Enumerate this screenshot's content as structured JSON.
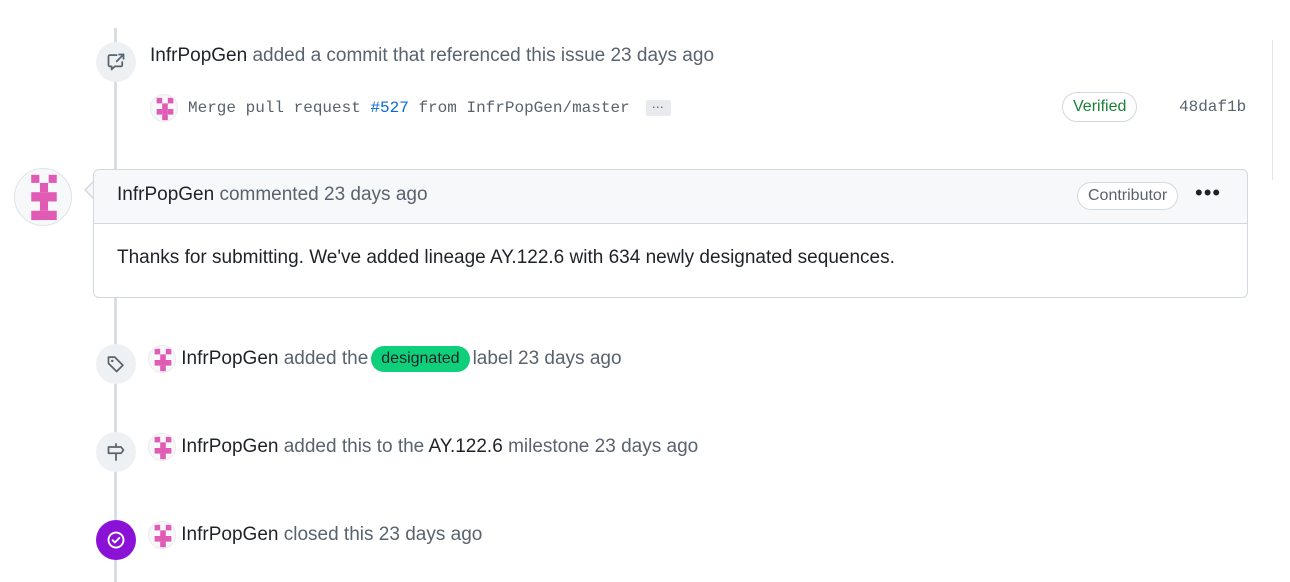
{
  "events": {
    "commit_ref": {
      "actor": "InfrPopGen",
      "text": "added a commit that referenced this issue",
      "time": "23 days ago",
      "commit": {
        "message_prefix": "Merge pull request",
        "pr_ref": "#527",
        "message_suffix": "from InfrPopGen/master",
        "ellipsis": "⋯",
        "verified_label": "Verified",
        "sha": "48daf1b"
      }
    },
    "comment": {
      "actor": "InfrPopGen",
      "action": "commented",
      "time": "23 days ago",
      "role_badge": "Contributor",
      "menu": "•••",
      "body": "Thanks for submitting. We've added lineage AY.122.6 with 634 newly designated sequences."
    },
    "labeled": {
      "actor": "InfrPopGen",
      "text_before": "added the",
      "label": "designated",
      "label_color": "#0ed07b",
      "text_after": "label",
      "time": "23 days ago"
    },
    "milestoned": {
      "actor": "InfrPopGen",
      "text_before": "added this to the",
      "milestone": "AY.122.6",
      "text_after": "milestone",
      "time": "23 days ago"
    },
    "closed": {
      "actor": "InfrPopGen",
      "text": "closed this",
      "time": "23 days ago",
      "icon_color": "#8a12d6"
    }
  },
  "icons": {
    "commit_ref": "cross-reference-icon",
    "labeled": "tag-icon",
    "milestoned": "milestone-icon",
    "closed": "check-circle-icon"
  }
}
